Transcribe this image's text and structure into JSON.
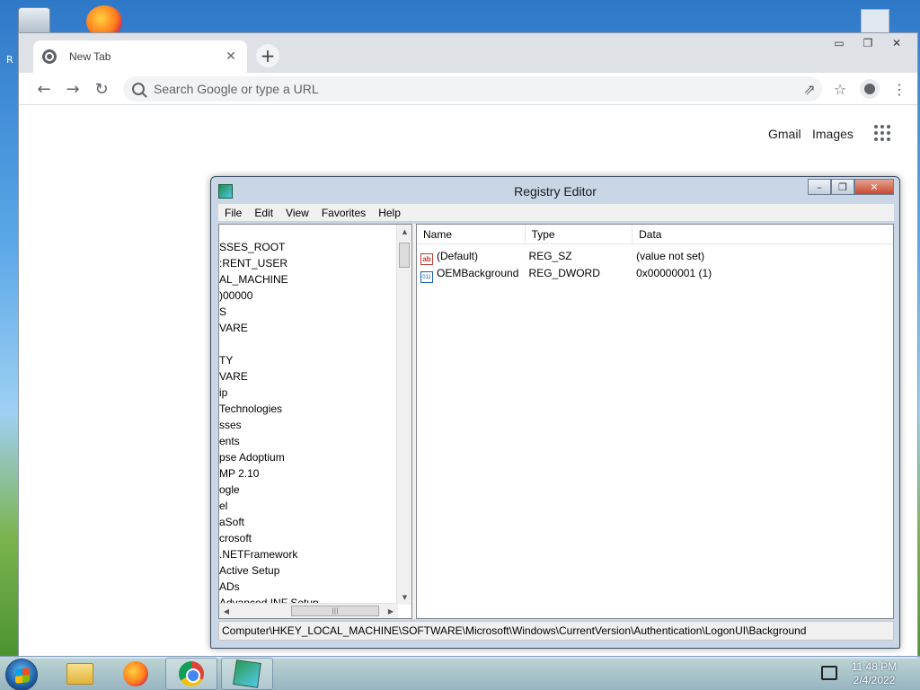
{
  "desktop": {
    "left_text": "R"
  },
  "chrome": {
    "tab_title": "New Tab",
    "tab_close": "✕",
    "new_tab": "+",
    "omnibox_placeholder": "Search Google or type a URL",
    "links": {
      "gmail": "Gmail",
      "images": "Images"
    },
    "caption": {
      "minimize": "▭",
      "restore": "❐",
      "close": "✕"
    }
  },
  "regedit": {
    "title": "Registry Editor",
    "caption": {
      "minimize": "–",
      "restore": "❐",
      "close": "✕"
    },
    "menu": [
      "File",
      "Edit",
      "View",
      "Favorites",
      "Help"
    ],
    "tree": [
      "SSES_ROOT",
      ":RENT_USER",
      "AL_MACHINE",
      ")00000",
      "S",
      "VARE",
      "",
      "TY",
      "VARE",
      "ip",
      " Technologies",
      "sses",
      "ents",
      "pse Adoptium",
      "MP 2.10",
      "ogle",
      "el",
      "aSoft",
      "crosoft",
      ".NETFramework",
      " Active Setup",
      "ADs",
      " Advanced INF Setup"
    ],
    "columns": [
      "Name",
      "Type",
      "Data"
    ],
    "values": [
      {
        "icon": "string-value-icon",
        "name": "(Default)",
        "type": "REG_SZ",
        "data": "(value not set)"
      },
      {
        "icon": "binary-value-icon",
        "name": "OEMBackground",
        "type": "REG_DWORD",
        "data": "0x00000001 (1)"
      }
    ],
    "status_path": "Computer\\HKEY_LOCAL_MACHINE\\SOFTWARE\\Microsoft\\Windows\\CurrentVersion\\Authentication\\LogonUI\\Background"
  },
  "taskbar": {
    "time": "11:48 PM",
    "date": "2/4/2022"
  }
}
